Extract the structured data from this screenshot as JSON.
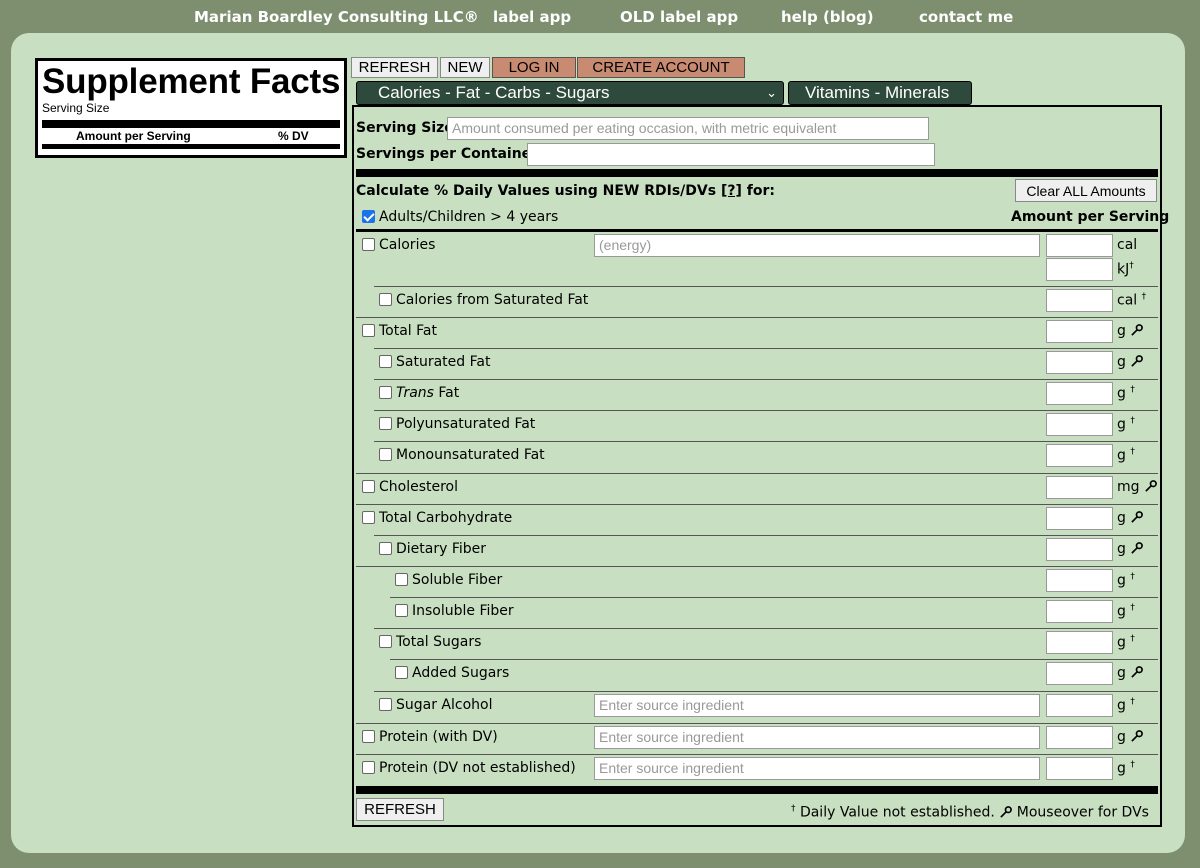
{
  "nav": {
    "brand": "Marian Boardley Consulting LLC®",
    "label_app": "label app",
    "old_label_app": "OLD label app",
    "help": "help (blog)",
    "contact": "contact me"
  },
  "label_preview": {
    "title": "Supplement Facts",
    "serving_size": "Serving Size",
    "amount_per_serving": "Amount per Serving",
    "dv": "% DV"
  },
  "toolbar": {
    "refresh": "REFRESH",
    "new": "NEW",
    "login": "LOG IN",
    "create_account": "CREATE ACCOUNT",
    "section_select": "Calories - Fat - Carbs - Sugars",
    "vitamins": "Vitamins - Minerals"
  },
  "form": {
    "serving_size_label": "Serving Size",
    "serving_size_placeholder": "Amount consumed per eating occasion, with metric equivalent",
    "servings_per_container_label": "Servings per Container",
    "calc_label_pre": "Calculate % Daily Values using NEW RDIs/DVs ",
    "calc_link": "[?]",
    "calc_label_post": " for:",
    "clear_all": "Clear ALL Amounts",
    "adults_label": "Adults/Children > 4 years",
    "amount_per_serving": "Amount per Serving",
    "energy_placeholder": "(energy)",
    "source_placeholder": "Enter source ingredient",
    "refresh_bottom": "REFRESH",
    "footnote_dagger": "†",
    "footnote_text": " Daily Value not established. ",
    "footnote_mouseover": " Mouseover for DVs"
  },
  "nutrients": {
    "calories": {
      "label": "Calories",
      "unit1": "cal",
      "unit2": "kJ"
    },
    "cal_sat_fat": {
      "label": "Calories from Saturated Fat",
      "unit": "cal"
    },
    "total_fat": {
      "label": "Total Fat",
      "unit": "g"
    },
    "sat_fat": {
      "label": "Saturated Fat",
      "unit": "g"
    },
    "trans_fat": {
      "label_em": "Trans",
      "label_rest": " Fat",
      "unit": "g"
    },
    "poly_fat": {
      "label": "Polyunsaturated Fat",
      "unit": "g"
    },
    "mono_fat": {
      "label": "Monounsaturated Fat",
      "unit": "g"
    },
    "cholesterol": {
      "label": "Cholesterol",
      "unit": "mg"
    },
    "total_carb": {
      "label": "Total Carbohydrate",
      "unit": "g"
    },
    "dietary_fiber": {
      "label": "Dietary Fiber",
      "unit": "g"
    },
    "soluble_fiber": {
      "label": "Soluble Fiber",
      "unit": "g"
    },
    "insoluble_fiber": {
      "label": "Insoluble Fiber",
      "unit": "g"
    },
    "total_sugars": {
      "label": "Total Sugars",
      "unit": "g"
    },
    "added_sugars": {
      "label": "Added Sugars",
      "unit": "g"
    },
    "sugar_alcohol": {
      "label": "Sugar Alcohol",
      "unit": "g"
    },
    "protein_dv": {
      "label": "Protein (with DV)",
      "unit": "g"
    },
    "protein_nodv": {
      "label": "Protein (DV not established)",
      "unit": "g"
    },
    "dagger": "†"
  }
}
